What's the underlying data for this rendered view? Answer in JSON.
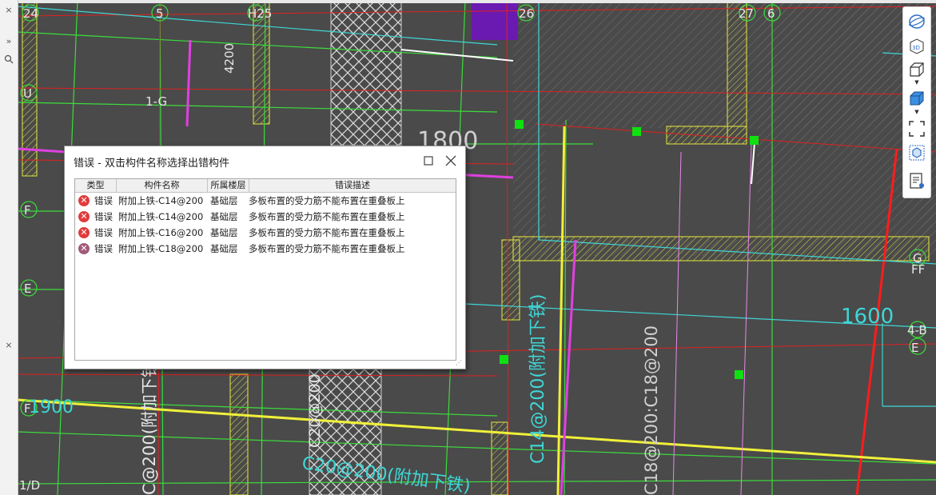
{
  "dialog": {
    "title": "错误 - 双击构件名称选择出错构件",
    "maximize_icon": "square-icon",
    "close_icon": "x-icon",
    "columns": [
      "类型",
      "构件名称",
      "所属楼层",
      "错误描述"
    ],
    "rows": [
      {
        "type": "错误",
        "name": "附加上铁-C14@200",
        "floor": "基础层",
        "desc": "多板布置的受力筋不能布置在重叠板上",
        "icon_color": "#e23b3b"
      },
      {
        "type": "错误",
        "name": "附加上铁-C14@200",
        "floor": "基础层",
        "desc": "多板布置的受力筋不能布置在重叠板上",
        "icon_color": "#e23b3b"
      },
      {
        "type": "错误",
        "name": "附加上铁-C16@200",
        "floor": "基础层",
        "desc": "多板布置的受力筋不能布置在重叠板上",
        "icon_color": "#e23b3b"
      },
      {
        "type": "错误",
        "name": "附加上铁-C18@200",
        "floor": "基础层",
        "desc": "多板布置的受力筋不能布置在重叠板上",
        "icon_color": "#a15a7a"
      }
    ]
  },
  "cad": {
    "axis_labels": {
      "a24": "24",
      "a5": "5",
      "h25": "H25",
      "a26": "26",
      "a27": "27",
      "a6": "6",
      "u": "U",
      "g1": "1-G",
      "f": "F",
      "e": "E",
      "f2": "F",
      "d1": "1/D",
      "g_right": "G",
      "ff_right": "FF",
      "b4_right": "4-B",
      "e_right": "E"
    },
    "dimensions": {
      "d4200": "4200",
      "d1800": "1800",
      "d1600": "1600",
      "d1900": "1900"
    },
    "rebar_labels": {
      "c14": "C14@200(附加下铁)",
      "c18": "C18@200:C18@200",
      "c20": "C20@200(附加下铁)",
      "c200_left": "C@200(附加下铁)",
      "c20_mid": "C20@200"
    }
  },
  "toolbar": {
    "icons": [
      "orbit-icon",
      "3d-view-icon",
      "box-view-icon",
      "solid-box-icon",
      "fullscreen-icon",
      "layer-cube-icon",
      "report-icon"
    ],
    "label_3d": "3D"
  },
  "left_strip": {
    "collapse_icon": "double-chevron-icon",
    "search_icon": "search-icon",
    "close_icon": "x-icon"
  },
  "colors": {
    "cad_bg": "#4a4a4a",
    "axis_green": "#3cdc3c",
    "red_line": "#e02020",
    "cyan": "#3fd6d6",
    "yellow": "#e8e83c",
    "magenta": "#e040e0",
    "purple_block": "#6a1ab0",
    "grip_green": "#10e010"
  }
}
